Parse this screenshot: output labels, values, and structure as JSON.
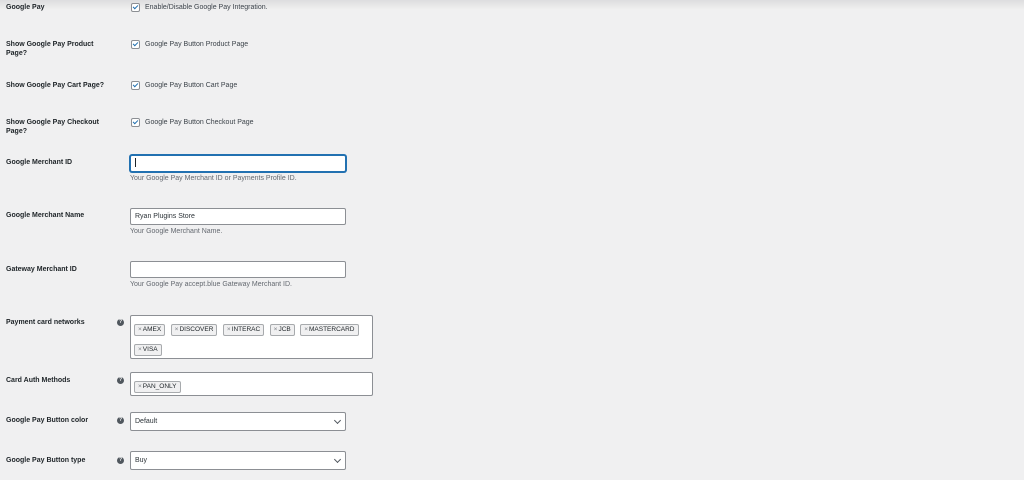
{
  "google_pay": {
    "label": "Google Pay",
    "checkbox_text": "Enable/Disable Google Pay Integration.",
    "checked": true
  },
  "product_page": {
    "label": "Show Google Pay Product Page?",
    "checkbox_text": "Google Pay Button Product Page",
    "checked": true
  },
  "cart_page": {
    "label": "Show Google Pay Cart Page?",
    "checkbox_text": "Google Pay Button Cart Page",
    "checked": true
  },
  "checkout_page": {
    "label": "Show Google Pay Checkout Page?",
    "checkbox_text": "Google Pay Button Checkout Page",
    "checked": true
  },
  "merchant_id": {
    "label": "Google Merchant ID",
    "value": "",
    "description": "Your Google Pay Merchant ID or Payments Profile ID."
  },
  "merchant_name": {
    "label": "Google Merchant Name",
    "value": "Ryan Plugins Store",
    "description": "Your Google Merchant Name."
  },
  "gateway_merchant_id": {
    "label": "Gateway Merchant ID",
    "value": "",
    "description": "Your Google Pay accept.blue Gateway Merchant ID."
  },
  "card_networks": {
    "label": "Payment card networks",
    "help_icon": "question-circle-icon",
    "tags": [
      "AMEX",
      "DISCOVER",
      "INTERAC",
      "JCB",
      "MASTERCARD",
      "VISA"
    ],
    "remove_symbol": "×"
  },
  "auth_methods": {
    "label": "Card Auth Methods",
    "help_icon": "question-circle-icon",
    "tags": [
      "PAN_ONLY"
    ],
    "remove_symbol": "×"
  },
  "button_color": {
    "label": "Google Pay Button color",
    "help_icon": "question-circle-icon",
    "selected": "Default"
  },
  "button_type": {
    "label": "Google Pay Button type",
    "help_icon": "question-circle-icon",
    "selected": "Buy"
  }
}
